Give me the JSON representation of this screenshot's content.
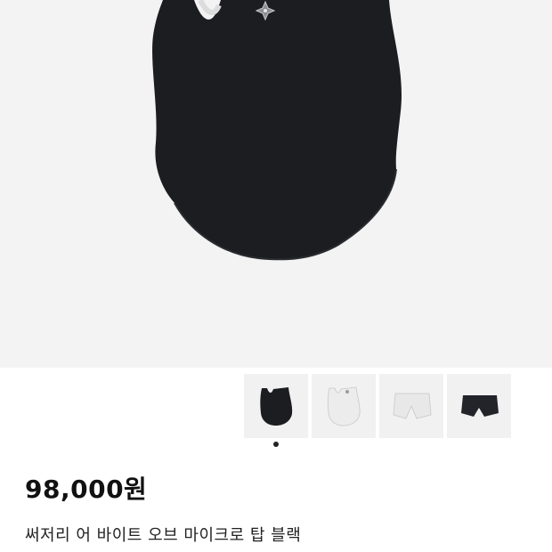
{
  "product": {
    "price": "98,000원",
    "name": "써저리 어 바이트 오브 마이크로 탑 블랙"
  },
  "gallery": {
    "thumbnails": [
      {
        "color": "black top",
        "fill": "#1c1d21",
        "selected": true
      },
      {
        "color": "white top",
        "fill": "#e9e9e9",
        "selected": false
      },
      {
        "color": "white shorts",
        "fill": "#e4e4e4",
        "selected": false
      },
      {
        "color": "black shorts",
        "fill": "#22242a",
        "selected": false
      }
    ],
    "active_index": 0
  },
  "colors": {
    "hero_background": "#f3f3f3",
    "garment": "#1c1d21"
  }
}
